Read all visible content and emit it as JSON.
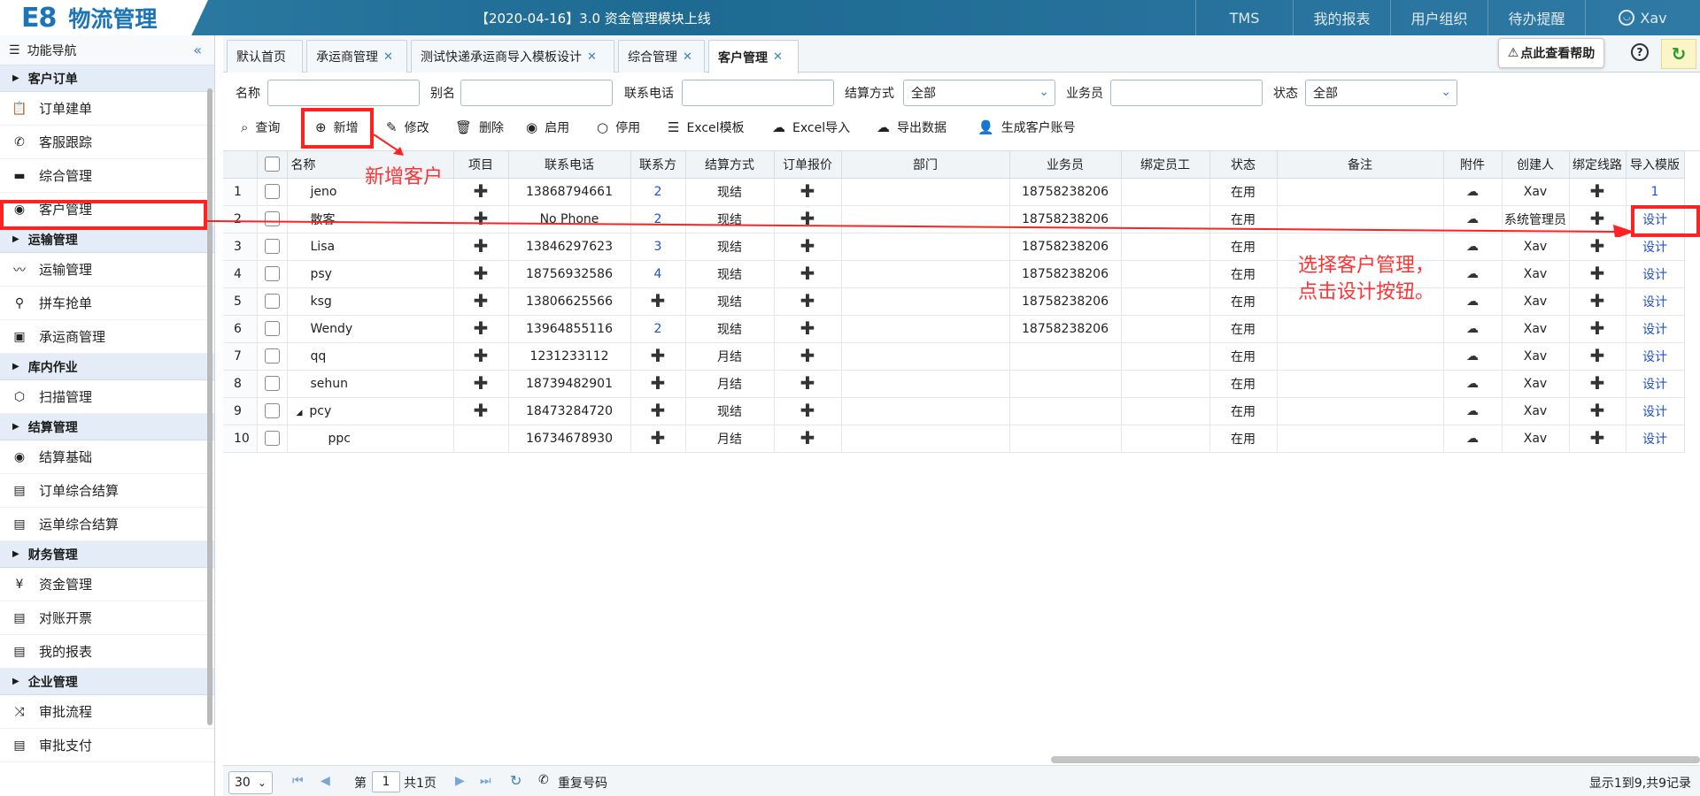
{
  "header": {
    "logo_e8": "E8",
    "logo_text": "物流管理",
    "notice": "【2020-04-16】3.0 资金管理模块上线",
    "nav": [
      "TMS",
      "我的报表",
      "用户组织",
      "待办提醒"
    ],
    "user": "Xav"
  },
  "sidebar": {
    "title": "功能导航",
    "sections": [
      {
        "label": "客户订单",
        "items": [
          {
            "label": "订单建单",
            "icon": "clipboard-icon"
          },
          {
            "label": "客服跟踪",
            "icon": "phone-icon"
          },
          {
            "label": "综合管理",
            "icon": "monitor-icon"
          },
          {
            "label": "客户管理",
            "icon": "customer-icon"
          }
        ]
      },
      {
        "label": "运输管理",
        "items": [
          {
            "label": "运输管理",
            "icon": "route-icon"
          },
          {
            "label": "拼车抢单",
            "icon": "pin-icon"
          },
          {
            "label": "承运商管理",
            "icon": "bus-icon"
          }
        ]
      },
      {
        "label": "库内作业",
        "items": [
          {
            "label": "扫描管理",
            "icon": "box-icon"
          }
        ]
      },
      {
        "label": "结算管理",
        "items": [
          {
            "label": "结算基础",
            "icon": "eye-icon"
          },
          {
            "label": "订单综合结算",
            "icon": "document-icon"
          },
          {
            "label": "运单综合结算",
            "icon": "document-icon"
          }
        ]
      },
      {
        "label": "财务管理",
        "items": [
          {
            "label": "资金管理",
            "icon": "yen-icon"
          },
          {
            "label": "对账开票",
            "icon": "document-icon"
          },
          {
            "label": "我的报表",
            "icon": "document-icon"
          }
        ]
      },
      {
        "label": "企业管理",
        "items": [
          {
            "label": "审批流程",
            "icon": "shuffle-icon"
          },
          {
            "label": "审批支付",
            "icon": "document-icon"
          }
        ]
      }
    ]
  },
  "tabs": [
    {
      "label": "默认首页",
      "closable": false
    },
    {
      "label": "承运商管理",
      "closable": true
    },
    {
      "label": "测试快递承运商导入模板设计",
      "closable": true
    },
    {
      "label": "综合管理",
      "closable": true
    },
    {
      "label": "客户管理",
      "closable": true,
      "active": true
    }
  ],
  "help_label": "点此查看帮助",
  "filters": {
    "name_label": "名称",
    "alias_label": "别名",
    "phone_label": "联系电话",
    "settle_label": "结算方式",
    "settle_value": "全部",
    "salesman_label": "业务员",
    "status_label": "状态",
    "status_value": "全部"
  },
  "toolbar": [
    "查询",
    "新增",
    "修改",
    "删除",
    "启用",
    "停用",
    "Excel模板",
    "Excel导入",
    "导出数据",
    "生成客户账号"
  ],
  "grid": {
    "columns": [
      "名称",
      "项目",
      "联系电话",
      "联系方",
      "结算方式",
      "订单报价",
      "部门",
      "业务员",
      "绑定员工",
      "状态",
      "备注",
      "附件",
      "创建人",
      "绑定线路",
      "导入模版"
    ],
    "rows": [
      {
        "n": "1",
        "name": "jeno",
        "phone": "13868794661",
        "contact": "2",
        "settle": "现结",
        "salesman": "18758238206",
        "status": "在用",
        "creator": "Xav",
        "tpl": "1"
      },
      {
        "n": "2",
        "name": "散客",
        "phone": "No Phone",
        "contact": "2",
        "settle": "现结",
        "salesman": "18758238206",
        "status": "在用",
        "creator": "系统管理员",
        "tpl": "设计"
      },
      {
        "n": "3",
        "name": "Lisa",
        "phone": "13846297623",
        "contact": "3",
        "settle": "现结",
        "salesman": "18758238206",
        "status": "在用",
        "creator": "Xav",
        "tpl": "设计"
      },
      {
        "n": "4",
        "name": "psy",
        "phone": "18756932586",
        "contact": "4",
        "settle": "现结",
        "salesman": "18758238206",
        "status": "在用",
        "creator": "Xav",
        "tpl": "设计"
      },
      {
        "n": "5",
        "name": "ksg",
        "phone": "13806625566",
        "contact": "",
        "settle": "现结",
        "salesman": "18758238206",
        "status": "在用",
        "creator": "Xav",
        "tpl": "设计"
      },
      {
        "n": "6",
        "name": "Wendy",
        "phone": "13964855116",
        "contact": "2",
        "settle": "现结",
        "salesman": "18758238206",
        "status": "在用",
        "creator": "Xav",
        "tpl": "设计"
      },
      {
        "n": "7",
        "name": "qq",
        "phone": "1231233112",
        "contact": "",
        "settle": "月结",
        "salesman": "",
        "status": "在用",
        "creator": "Xav",
        "tpl": "设计"
      },
      {
        "n": "8",
        "name": "sehun",
        "phone": "18739482901",
        "contact": "",
        "settle": "月结",
        "salesman": "",
        "status": "在用",
        "creator": "Xav",
        "tpl": "设计"
      },
      {
        "n": "9",
        "name": "pcy",
        "phone": "18473284720",
        "contact": "",
        "settle": "现结",
        "salesman": "",
        "status": "在用",
        "creator": "Xav",
        "tpl": "设计",
        "expanded": true
      },
      {
        "n": "10",
        "name": "ppc",
        "phone": "16734678930",
        "contact": "",
        "settle": "月结",
        "salesman": "",
        "status": "在用",
        "creator": "Xav",
        "tpl": "设计",
        "child": true
      }
    ]
  },
  "pager": {
    "page_size": "30",
    "page_prefix": "第",
    "page_value": "1",
    "page_suffix": "共1页",
    "dup_label": "重复号码",
    "summary": "显示1到9,共9记录"
  },
  "annotations": {
    "add_text": "新增客户",
    "design_text_1": "选择客户管理，",
    "design_text_2": "点击设计按钮。"
  },
  "colors": {
    "accent": "#1f6e99",
    "annotation": "#ff2222",
    "link": "#1f50d4"
  }
}
